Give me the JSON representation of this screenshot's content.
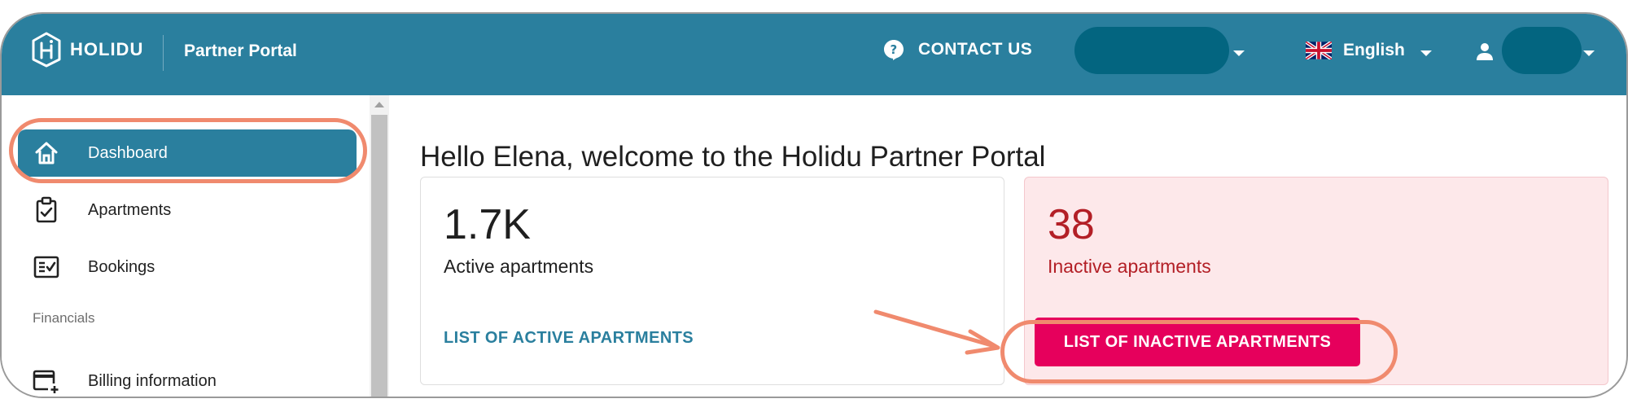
{
  "header": {
    "brand": "HOLIDU",
    "portal_title": "Partner Portal",
    "contact_label": "CONTACT US",
    "language_label": "English",
    "language_flag_icon": "uk-flag-icon",
    "colors": {
      "header_bg": "#2a7f9e",
      "pill_bg": "#036580"
    }
  },
  "sidebar": {
    "items": [
      {
        "label": "Dashboard",
        "icon": "home-icon",
        "active": true
      },
      {
        "label": "Apartments",
        "icon": "clipboard-check-icon"
      },
      {
        "label": "Bookings",
        "icon": "checklist-icon"
      }
    ],
    "section_financials": "Financials",
    "financial_items": [
      {
        "label": "Billing information",
        "icon": "credit-card-add-icon"
      }
    ]
  },
  "main": {
    "welcome": "Hello Elena, welcome to the Holidu Partner Portal",
    "cards": {
      "active": {
        "count": "1.7K",
        "label": "Active apartments",
        "link": "LIST OF ACTIVE APARTMENTS",
        "color": "#2a7f9e"
      },
      "inactive": {
        "count": "38",
        "label": "Inactive apartments",
        "button": "LIST OF INACTIVE APARTMENTS",
        "bg_color": "#fde8ea",
        "text_color": "#b31f26",
        "button_color": "#e6005c"
      }
    }
  },
  "annotations": {
    "highlight_color": "#f08a6e"
  }
}
